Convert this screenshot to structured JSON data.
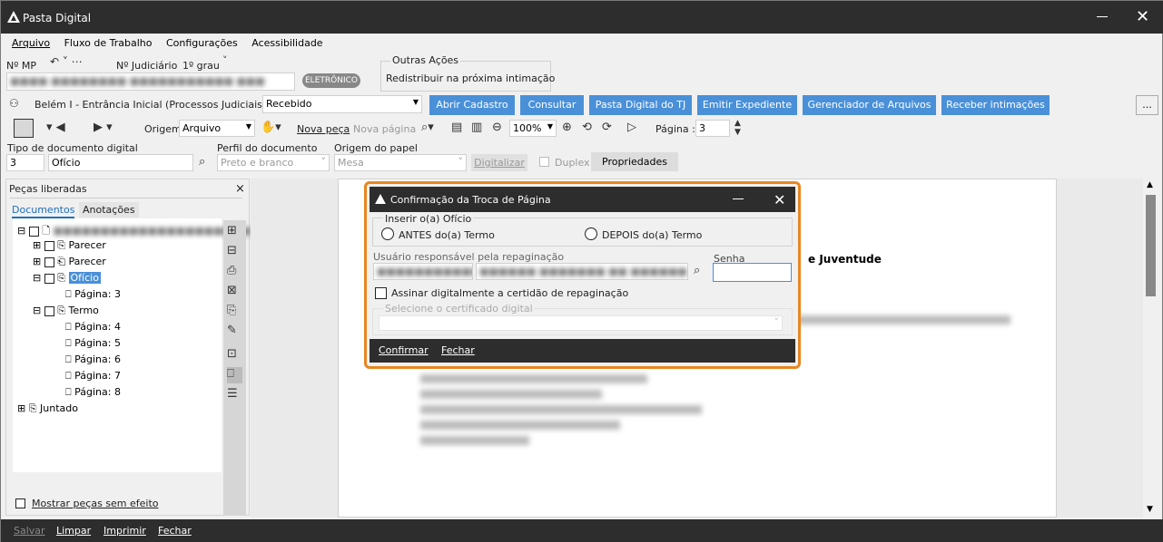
{
  "app": {
    "title": "Pasta Digital"
  },
  "menu": [
    "Arquivo",
    "Fluxo de Trabalho",
    "Configurações",
    "Acessibilidade"
  ],
  "header": {
    "mp_label": "Nº MP",
    "judicial_label": "Nº Judiciário",
    "degree": "1º grau",
    "eletronico_badge": "ELETRÔNICO",
    "outras_acoes_label": "Outras Ações",
    "outras_acoes_value": "Redistribuir na próxima intimação",
    "fila_label": "Belém I - Entrância Inicial (Processos Judiciais) - Fila",
    "fila_value": "Recebido",
    "more_btn": "..."
  },
  "action_buttons": [
    "Abrir Cadastro",
    "Consultar",
    "Pasta Digital do TJ",
    "Emitir Expediente",
    "Gerenciador de Arquivos",
    "Receber intimações"
  ],
  "toolbar": {
    "origem_label": "Origem",
    "origem_value": "Arquivo",
    "nova_peca": "Nova peça",
    "nova_pagina": "Nova página",
    "zoom": "100%",
    "pagina_label": "Página :",
    "pagina_value": "3"
  },
  "docform": {
    "tipo_label": "Tipo de documento digital",
    "tipo_code": "3",
    "tipo_value": "Ofício",
    "perfil_label": "Perfil do documento",
    "perfil_value": "Preto e branco",
    "origem_papel_label": "Origem do papel",
    "origem_papel_value": "Mesa",
    "digitalizar": "Digitalizar",
    "duplex": "Duplex",
    "propriedades": "Propriedades"
  },
  "panel": {
    "title": "Peças liberadas",
    "tabs": [
      "Documentos",
      "Anotações"
    ],
    "tree": [
      {
        "label": "Parecer"
      },
      {
        "label": "Parecer"
      },
      {
        "label": "Ofício"
      },
      {
        "label": "Página: 3"
      },
      {
        "label": "Termo"
      },
      {
        "label": "Página: 4"
      },
      {
        "label": "Página: 5"
      },
      {
        "label": "Página: 6"
      },
      {
        "label": "Página: 7"
      },
      {
        "label": "Página: 8"
      },
      {
        "label": "Juntado"
      }
    ],
    "mostrar": "Mostrar peças sem efeito"
  },
  "document": {
    "visible_text": "e Juventude"
  },
  "dialog": {
    "title": "Confirmação da Troca de Página",
    "group_label": "Inserir o(a) Ofício",
    "antes": "ANTES do(a) Termo",
    "depois": "DEPOIS do(a) Termo",
    "usuario_label": "Usuário responsável pela repaginação",
    "senha_label": "Senha",
    "assinar": "Assinar digitalmente a certidão de repaginação",
    "certificado_placeholder": "Selecione o certificado digital",
    "confirmar": "Confirmar",
    "fechar": "Fechar"
  },
  "statusbar": [
    "Salvar",
    "Limpar",
    "Imprimir",
    "Fechar"
  ]
}
